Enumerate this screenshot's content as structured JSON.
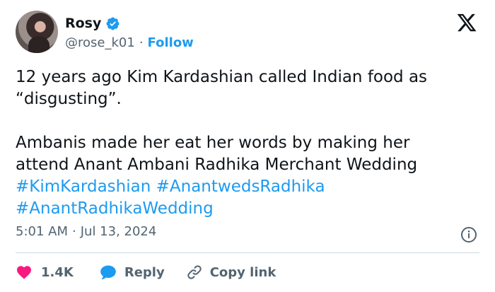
{
  "author": {
    "display_name": "Rosy",
    "handle": "@rose_k01",
    "separator": "·",
    "follow_label": "Follow"
  },
  "tweet": {
    "line1": "12 years ago Kim Kardashian called Indian food as",
    "line2": "“disgusting”.",
    "line3": "Ambanis made her eat her words by making her",
    "line4": "attend Anant Ambani Radhika Merchant Wedding",
    "hashtags": [
      "#KimKardashian",
      "#AnantwedsRadhika",
      "#AnantRadhikaWedding"
    ]
  },
  "meta": {
    "time": "5:01 AM",
    "separator": "·",
    "date": "Jul 13, 2024"
  },
  "actions": {
    "like_count": "1.4K",
    "reply_label": "Reply",
    "copy_link_label": "Copy link"
  },
  "colors": {
    "accent": "#1d9bf0",
    "like": "#f91880",
    "muted": "#536471",
    "text": "#0f1419"
  },
  "icons": [
    "verified-badge-icon",
    "x-logo-icon",
    "info-icon",
    "heart-icon",
    "reply-bubble-icon",
    "link-icon"
  ]
}
